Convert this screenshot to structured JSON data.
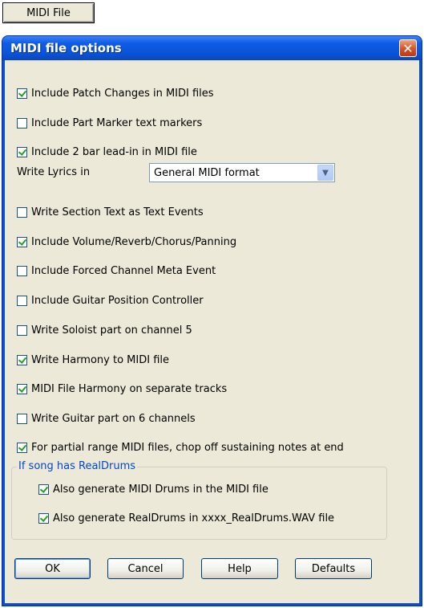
{
  "top_button": {
    "label": "MIDI File"
  },
  "dialog": {
    "title": "MIDI file options",
    "close_symbol": "✕",
    "options": [
      {
        "label": "Include Patch Changes in MIDI files",
        "checked": true
      },
      {
        "label": "Include Part Marker text  markers",
        "checked": false
      },
      {
        "label": "Include 2 bar lead-in in MIDI file",
        "checked": true
      }
    ],
    "lyrics": {
      "label": "Write Lyrics in",
      "value": "General MIDI format",
      "arrow_icon": "chevron-down-icon"
    },
    "options2": [
      {
        "label": "Write Section Text as Text Events",
        "checked": false
      },
      {
        "label": "Include Volume/Reverb/Chorus/Panning",
        "checked": true
      },
      {
        "label": "Include Forced Channel Meta Event",
        "checked": false
      },
      {
        "label": "Include Guitar Position Controller",
        "checked": false
      },
      {
        "label": "Write Soloist part on channel 5",
        "checked": false
      },
      {
        "label": "Write Harmony to MIDI file",
        "checked": true
      },
      {
        "label": "MIDI File Harmony on separate tracks",
        "checked": true
      },
      {
        "label": "Write Guitar part on 6 channels",
        "checked": false
      },
      {
        "label": "For partial range MIDI files, chop off sustaining notes at end",
        "checked": true
      }
    ],
    "realdrums": {
      "title": "If song has RealDrums",
      "items": [
        {
          "label": "Also generate MIDI Drums in the MIDI file",
          "checked": true
        },
        {
          "label": "Also generate RealDrums in xxxx_RealDrums.WAV file",
          "checked": true
        }
      ]
    },
    "buttons": {
      "ok": "OK",
      "cancel": "Cancel",
      "help": "Help",
      "defaults": "Defaults"
    }
  },
  "colors": {
    "titlebar": "#0a54d8",
    "face": "#ece9d8",
    "group_title": "#0046d5",
    "check": "#21a121"
  }
}
